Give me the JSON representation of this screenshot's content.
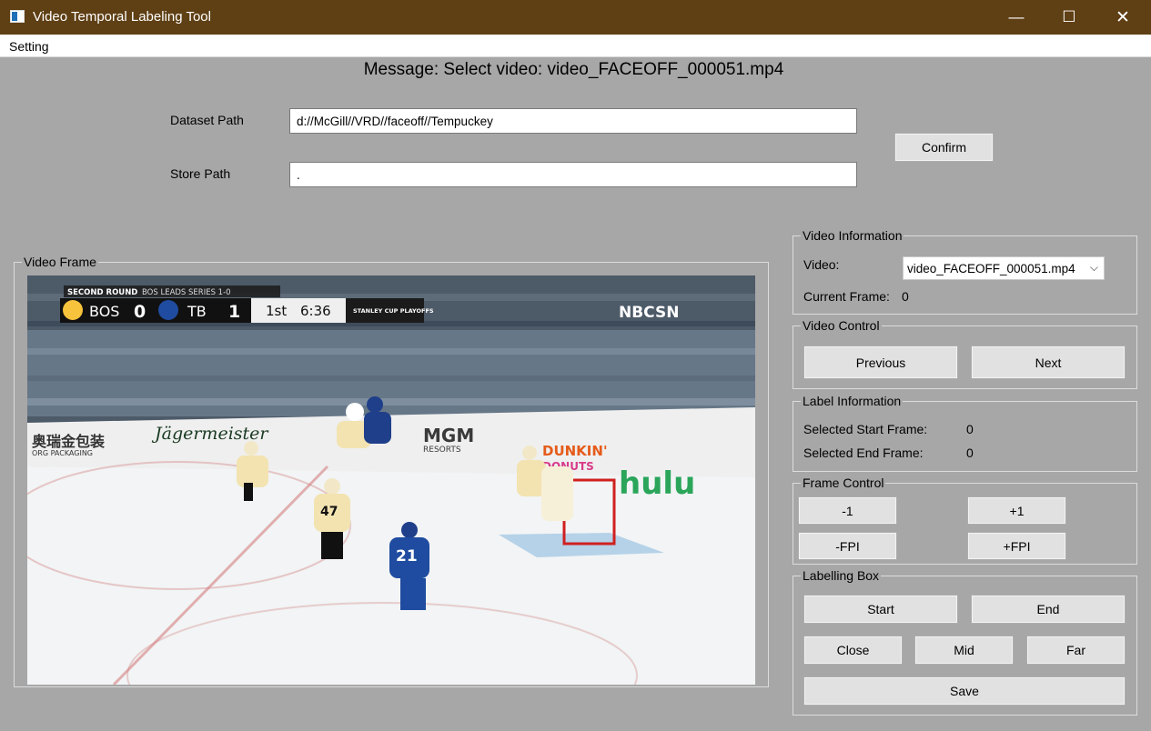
{
  "window": {
    "title": "Video Temporal Labeling Tool",
    "minimize": "—",
    "maximize": "☐",
    "close": "✕"
  },
  "menu": {
    "items": [
      "Setting"
    ]
  },
  "message": "Message: Select video: video_FACEOFF_000051.mp4",
  "paths": {
    "dataset_label": "Dataset Path",
    "dataset_value": "d://McGill//VRD//faceoff//Tempuckey",
    "store_label": "Store Path",
    "store_value": ".",
    "confirm": "Confirm"
  },
  "video_frame": {
    "title": "Video Frame",
    "scoreboard": {
      "round": "SECOND ROUND",
      "series": "BOS LEADS SERIES 1-0",
      "team1": "BOS",
      "score1": "0",
      "team2": "TB",
      "score2": "1",
      "period": "1st",
      "clock": "6:36",
      "logo": "STANLEY CUP PLAYOFFS"
    },
    "network": "NBCSN",
    "boards": [
      "奥瑞金包装",
      "ORG PACKAGING",
      "Jägermeister",
      "MGM",
      "RESORTS",
      "DUNKIN'",
      "DONUTS",
      "hulu"
    ],
    "player_number": "21",
    "player_number_2": "47"
  },
  "video_information": {
    "title": "Video Information",
    "video_label": "Video:",
    "video_selected": "video_FACEOFF_000051.mp4",
    "current_frame_label": "Current Frame:",
    "current_frame_value": "0"
  },
  "video_control": {
    "title": "Video Control",
    "previous": "Previous",
    "next": "Next"
  },
  "label_information": {
    "title": "Label Information",
    "start_label": "Selected Start Frame:",
    "start_value": "0",
    "end_label": "Selected End Frame:",
    "end_value": "0"
  },
  "frame_control": {
    "title": "Frame Control",
    "minus1": "-1",
    "plus1": "+1",
    "minus_fpi": "-FPI",
    "plus_fpi": "+FPI"
  },
  "labelling_box": {
    "title": "Labelling Box",
    "start": "Start",
    "end": "End",
    "close": "Close",
    "mid": "Mid",
    "far": "Far",
    "save": "Save"
  }
}
